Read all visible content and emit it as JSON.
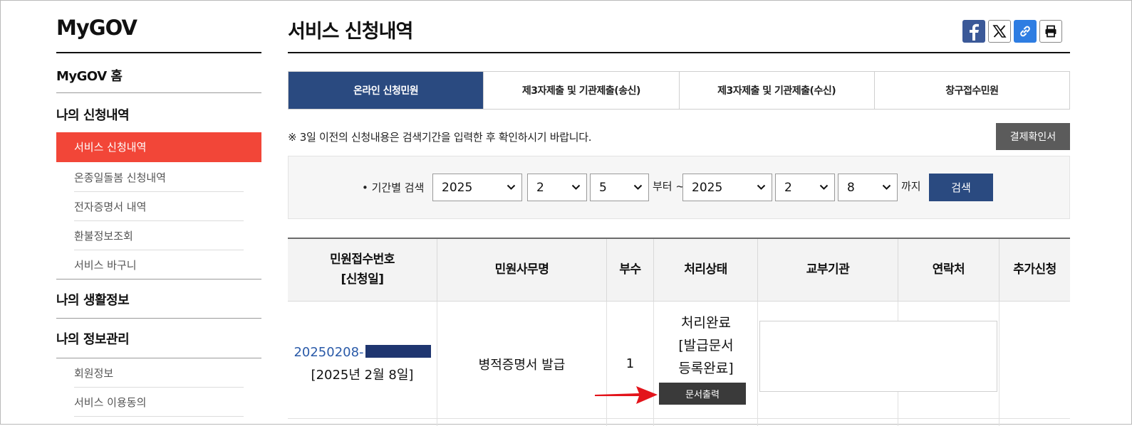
{
  "sidebar": {
    "brand": "MyGOV",
    "home": "MyGOV 홈",
    "section_apps": "나의 신청내역",
    "apps_items": [
      "서비스 신청내역",
      "온종일돌봄 신청내역",
      "전자증명서 내역",
      "환불정보조회",
      "서비스 바구니"
    ],
    "section_life": "나의 생활정보",
    "section_info": "나의 정보관리",
    "info_items": [
      "회원정보",
      "서비스 이용동의"
    ]
  },
  "header": {
    "title": "서비스 신청내역",
    "share_icons": [
      "facebook-icon",
      "x-twitter-icon",
      "link-icon",
      "print-icon"
    ]
  },
  "tabs": [
    "온라인 신청민원",
    "제3자제출 및 기관제출(송신)",
    "제3자제출 및 기관제출(수신)",
    "창구접수민원"
  ],
  "notice": "※ 3일 이전의 신청내용은 검색기간을 입력한 후 확인하시기 바랍니다.",
  "receipt_button": "결제확인서",
  "search": {
    "label": "• 기간별 검색",
    "from_year": "2025",
    "from_month": "2",
    "from_day": "5",
    "from_text": "부터 ~",
    "to_year": "2025",
    "to_month": "2",
    "to_day": "8",
    "to_text": "까지",
    "button": "검색"
  },
  "table": {
    "headers": [
      "민원접수번호\n[신청일]",
      "민원사무명",
      "부수",
      "처리상태",
      "교부기관",
      "연락처",
      "추가신청"
    ],
    "rows": [
      {
        "app_no": "20250208-",
        "app_date": "[2025년 2월 8일]",
        "service": "병적증명서 발급",
        "copies": "1",
        "status": "처리완료\n[발급문서\n등록완료]",
        "print_button": "문서출력"
      }
    ]
  },
  "colors": {
    "accent_red": "#f24638",
    "navy": "#2a4a80",
    "link_blue": "#2a5aa8",
    "dark_button": "#3a3a3a"
  }
}
